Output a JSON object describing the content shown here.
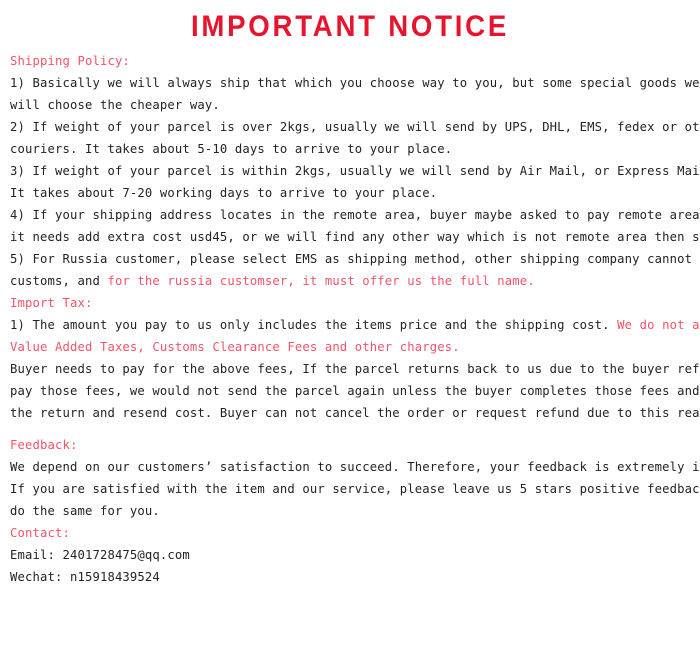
{
  "document": {
    "title": "IMPORTANT NOTICE",
    "colors": {
      "title_red": "#e8142d",
      "accent_red": "#f2546a",
      "body_text": "#232323",
      "background": "#ffffff"
    }
  },
  "sections": {
    "shipping_policy": {
      "heading": "Shipping Policy:",
      "lines": [
        "1) Basically we will always ship that which you choose way to you, but some special goods we",
        "will choose the cheaper way.",
        "2) If weight of your parcel is over 2kgs, usually we will send by UPS, DHL, EMS, fedex or other expedited",
        "couriers. It takes about 5-10 days to arrive to your place.",
        "3) If weight of your parcel is within 2kgs, usually we will send by Air Mail, or Express Mail Service.",
        "It takes about 7-20 working days to arrive to your place.",
        "4) If your shipping address locates in the remote area, buyer maybe asked to pay remote area charge.",
        "it needs add extra cost usd45, or we will find any other way which is not remote area then ship to you.",
        "5) For Russia customer, please select EMS as shipping method, other shipping company cannot clearance"
      ],
      "line_russia_prefix": "customs, and ",
      "line_russia_red": "for the russia customser, it must offer us the full name."
    },
    "import_tax": {
      "heading": "Import Tax:",
      "line1_black": "1) The amount you pay to us only includes the items price and the shipping cost. ",
      "line1_red": "We do not add Duties,",
      "line2_red": "Value Added Taxes, Customs Clearance Fees and other charges.",
      "lines": [
        "Buyer needs to pay for the above fees, If the parcel returns back to us due to the buyer refuse to",
        "pay those fees, we would not send the parcel again unless the buyer completes those fees and pay all",
        "the return and resend cost. Buyer can not cancel the order or request refund due to this reason."
      ]
    },
    "feedback": {
      "heading": "Feedback:",
      "lines": [
        "We depend on our customers’ satisfaction to succeed. Therefore, your feedback is extremely important to us.",
        "If you are satisfied with the item and our service, please leave us 5 stars positive feedback, and we will",
        "do the same for you."
      ]
    },
    "contact": {
      "heading": "Contact:",
      "email_line": "Email: 2401728475@qq.com",
      "wechat_line": "Wechat: n15918439524"
    }
  }
}
